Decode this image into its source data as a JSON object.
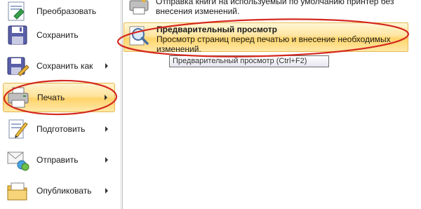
{
  "left_menu": {
    "items": [
      {
        "label": "Преобразовать",
        "icon": "convert-icon",
        "has_submenu": false
      },
      {
        "label": "Сохранить",
        "icon": "save-icon",
        "has_submenu": false
      },
      {
        "label": "Сохранить как",
        "icon": "save-as-icon",
        "has_submenu": true
      },
      {
        "label": "Печать",
        "icon": "print-icon",
        "has_submenu": true
      },
      {
        "label": "Подготовить",
        "icon": "prepare-icon",
        "has_submenu": true
      },
      {
        "label": "Отправить",
        "icon": "send-icon",
        "has_submenu": true
      },
      {
        "label": "Опубликовать",
        "icon": "publish-icon",
        "has_submenu": true
      }
    ]
  },
  "submenu": {
    "items": [
      {
        "title": "",
        "description": "Отправка книги на используемый по умолчанию принтер без внесения изменений.",
        "icon": "quick-print-icon"
      },
      {
        "title": "Предварительный просмотр",
        "description": "Просмотр страниц перед печатью и внесение необходимых изменений.",
        "icon": "magnifier-icon"
      }
    ]
  },
  "tooltip": "Предварительный просмотр (Ctrl+F2)",
  "colors": {
    "highlight": "#ffd56a",
    "highlight_border": "#e7bb55",
    "annotation": "#d42a1e"
  }
}
